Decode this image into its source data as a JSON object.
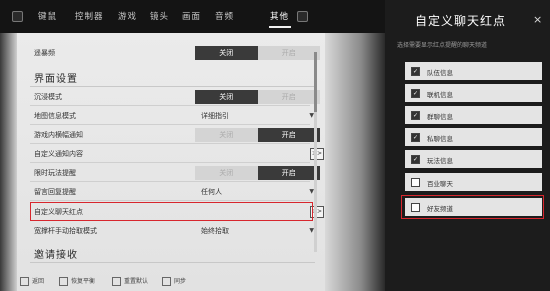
{
  "tabs": [
    {
      "label": "键鼠",
      "active": false
    },
    {
      "label": "控制器",
      "active": false
    },
    {
      "label": "游戏",
      "active": false
    },
    {
      "label": "镜头",
      "active": false
    },
    {
      "label": "画面",
      "active": false
    },
    {
      "label": "音频",
      "active": false
    },
    {
      "label": "其他",
      "active": true
    }
  ],
  "settings": {
    "rows": [
      {
        "label": "遥暴频",
        "type": "toggle",
        "options": [
          "关闭",
          "开启"
        ],
        "selected": 0
      },
      {
        "section": "界面设置"
      },
      {
        "label": "沉浸模式",
        "type": "toggle",
        "options": [
          "关闭",
          "开启"
        ],
        "selected": 0
      },
      {
        "label": "地图信息模式",
        "type": "dropdown",
        "value": "详细指引"
      },
      {
        "label": "游戏内横幅通知",
        "type": "toggle",
        "options": [
          "关闭",
          "开启"
        ],
        "selected": 1
      },
      {
        "label": "自定义通知内容",
        "type": "link",
        "arrow": ">>"
      },
      {
        "label": "限时玩法提醒",
        "type": "toggle",
        "options": [
          "关闭",
          "开启"
        ],
        "selected": 1
      },
      {
        "label": "留言回复提醒",
        "type": "dropdown",
        "value": "任何人"
      },
      {
        "label": "自定义聊天红点",
        "type": "link",
        "arrow": ">>",
        "highlighted": true
      },
      {
        "label": "宽撑杆手动拾取模式",
        "type": "dropdown",
        "value": "始终拾取"
      },
      {
        "section": "邀请接收"
      }
    ]
  },
  "bottom_hints": [
    {
      "label": "返回"
    },
    {
      "label": "恢复平衡"
    },
    {
      "label": "重置默认"
    },
    {
      "label": "同步"
    }
  ],
  "popup": {
    "title": "自定义聊天红点",
    "close": "×",
    "subtitle": "选择需要显示红点提醒的聊天频道",
    "options": [
      {
        "label": "队伍信息",
        "checked": true
      },
      {
        "label": "联机信息",
        "checked": true
      },
      {
        "label": "群聊信息",
        "checked": true
      },
      {
        "label": "私聊信息",
        "checked": true
      },
      {
        "label": "玩法信息",
        "checked": true
      },
      {
        "label": "百业聊天",
        "checked": false
      },
      {
        "label": "好友频道",
        "checked": false,
        "highlighted": true
      }
    ]
  },
  "colors": {
    "highlight": "#d7262d",
    "toggle_on": "#3a3a3a",
    "popup_bg": "#1c1c1c"
  }
}
